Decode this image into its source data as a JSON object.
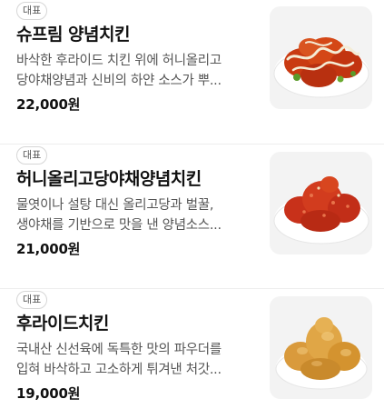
{
  "menu": {
    "items": [
      {
        "badge": "대표",
        "name": "슈프림 양념치킨",
        "desc_line1": "바삭한 후라이드 치킨 위에 허니올리고",
        "desc_line2": "당야채양념과 신비의 하얀 소스가 뿌...",
        "price": "22,000원",
        "image_icon": "chicken-photo-icon"
      },
      {
        "badge": "대표",
        "name": "허니올리고당야채양념치킨",
        "desc_line1": "물엿이나 설탕 대신 올리고당과 벌꿀,",
        "desc_line2": "생야채를 기반으로 맛을 낸 양념소스...",
        "price": "21,000원",
        "image_icon": "chicken-photo-icon"
      },
      {
        "badge": "대표",
        "name": "후라이드치킨",
        "desc_line1": "국내산 신선육에 독특한 맛의 파우더를",
        "desc_line2": "입혀 바삭하고 고소하게 튀겨낸 처갓...",
        "price": "19,000원",
        "image_icon": "chicken-photo-icon"
      }
    ]
  },
  "colors": {
    "sauce_red": "#c93a12",
    "fried_gold": "#d99a3c",
    "cream_sauce": "#f4ecd6",
    "plate": "#ffffff"
  }
}
